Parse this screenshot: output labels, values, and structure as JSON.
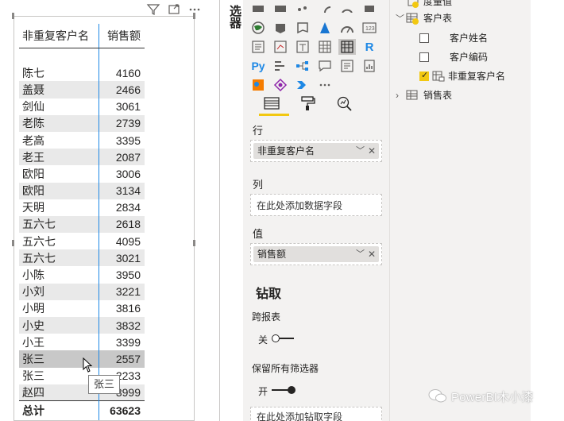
{
  "table": {
    "header_name": "非重复客户名",
    "header_sales": "销售额",
    "rows": [
      {
        "name": "陈七",
        "sales": "4160"
      },
      {
        "name": "盖聂",
        "sales": "2466"
      },
      {
        "name": "剑仙",
        "sales": "3061"
      },
      {
        "name": "老陈",
        "sales": "2739"
      },
      {
        "name": "老高",
        "sales": "3395"
      },
      {
        "name": "老王",
        "sales": "2087"
      },
      {
        "name": "欧阳",
        "sales": "3006"
      },
      {
        "name": "欧阳",
        "sales": "3134"
      },
      {
        "name": "天明",
        "sales": "2834"
      },
      {
        "name": "五六七",
        "sales": "2618"
      },
      {
        "name": "五六七",
        "sales": "4095"
      },
      {
        "name": "五六七",
        "sales": "3021"
      },
      {
        "name": "小陈",
        "sales": "3950"
      },
      {
        "name": "小刘",
        "sales": "3221"
      },
      {
        "name": "小明",
        "sales": "3816"
      },
      {
        "name": "小史",
        "sales": "3832"
      },
      {
        "name": "小王",
        "sales": "3399"
      },
      {
        "name": "张三",
        "sales": "2557"
      },
      {
        "name": "张三",
        "sales": "2233"
      },
      {
        "name": "赵四",
        "sales": "3999"
      }
    ],
    "total_label": "总计",
    "total_value": "63623",
    "tooltip": "张三"
  },
  "pane_title": "选器",
  "viz_tabs": [
    "fields-tab",
    "format-tab",
    "analytics-tab"
  ],
  "rows_well": {
    "label": "行",
    "field": "非重复客户名"
  },
  "columns_well": {
    "label": "列",
    "placeholder": "在此处添加数据字段"
  },
  "values_well": {
    "label": "值",
    "field": "销售额"
  },
  "drillthrough": {
    "heading": "钻取",
    "cross_report_label": "跨报表",
    "cross_report_state": "关",
    "keep_filters_label": "保留所有筛选器",
    "keep_filters_state": "开",
    "placeholder": "在此处添加钻取字段"
  },
  "fields": {
    "partial_top": "度量值",
    "customer_table": "客户表",
    "customer_name": "客户姓名",
    "customer_code": "客户编码",
    "distinct_customer": "非重复客户名",
    "sales_table": "销售表"
  },
  "watermark": "PowerBI木小漆",
  "colors": {
    "accent_yellow": "#f2c811",
    "selection_gray": "#c8c8c8",
    "divider_blue": "#1e88e5"
  }
}
